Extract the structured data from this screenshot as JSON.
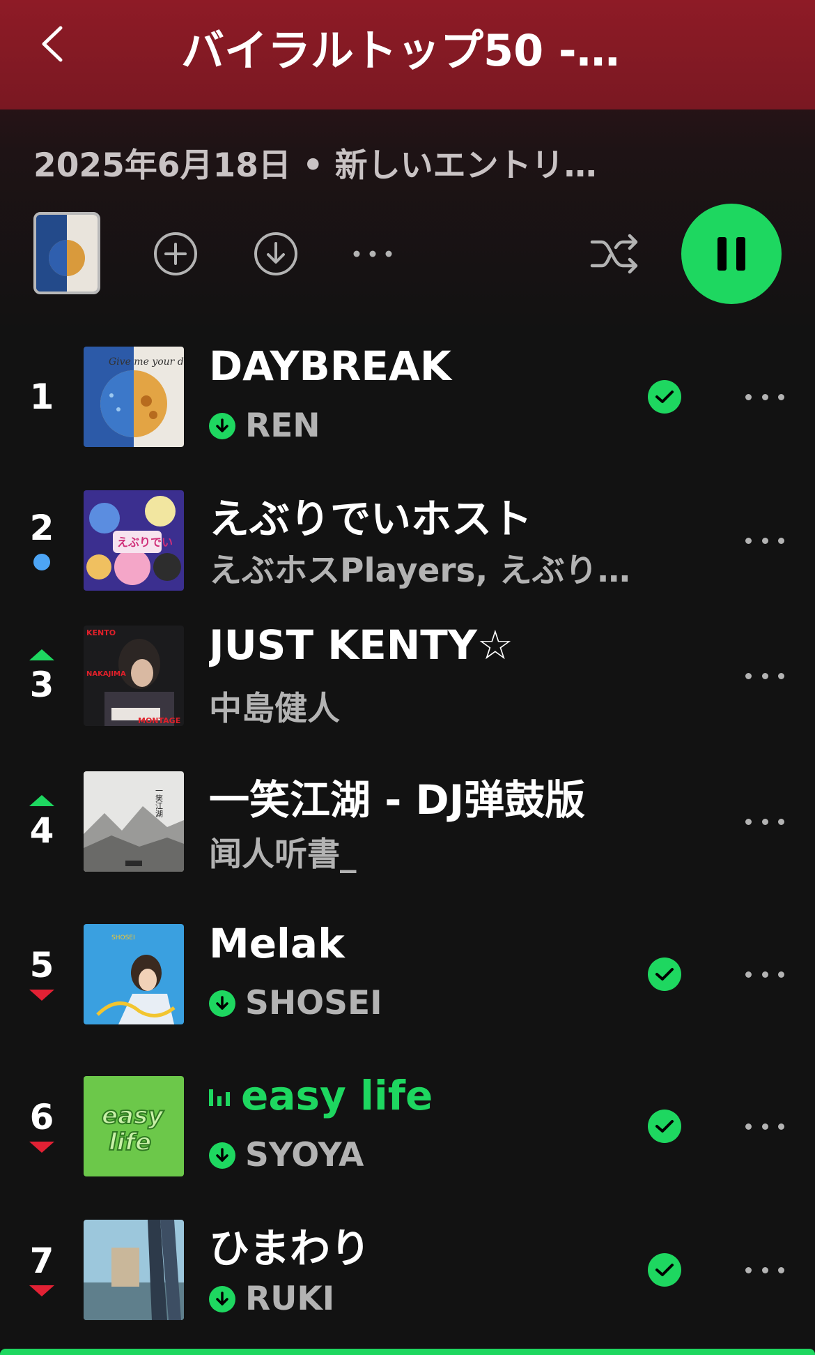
{
  "header": {
    "title": "バイラルトップ50 -…",
    "back_icon": "chevron-left-icon",
    "color": "#8e1b26"
  },
  "subtitle": "2025年6月18日 • 新しいエントリ…",
  "controls": {
    "icons": [
      "add-circle-icon",
      "download-icon",
      "more-icon",
      "shuffle-icon",
      "pause-icon"
    ]
  },
  "colors": {
    "accent": "#1ed760",
    "rank_up": "#1ed760",
    "rank_down": "#e22134",
    "rank_new": "#4da5f5"
  },
  "tracks": [
    {
      "rank": "1",
      "title": "DAYBREAK",
      "artist": "REN",
      "downloaded": true,
      "liked": true,
      "trend": "none"
    },
    {
      "rank": "2",
      "title": "えぶりでいホスト",
      "artist": "えぶホスPlayers, えぶり…",
      "downloaded": false,
      "liked": false,
      "trend": "new"
    },
    {
      "rank": "3",
      "title": "JUST KENTY☆",
      "artist": "中島健人",
      "downloaded": false,
      "liked": false,
      "trend": "up"
    },
    {
      "rank": "4",
      "title": "一笑江湖 - DJ弹鼓版",
      "artist": "闻人听書_",
      "downloaded": false,
      "liked": false,
      "trend": "up"
    },
    {
      "rank": "5",
      "title": "Melak",
      "artist": "SHOSEI",
      "downloaded": true,
      "liked": true,
      "trend": "down"
    },
    {
      "rank": "6",
      "title": "easy life",
      "artist": "SYOYA",
      "downloaded": true,
      "liked": true,
      "trend": "down",
      "playing": true
    },
    {
      "rank": "7",
      "title": "ひまわり",
      "artist": "RUKI",
      "downloaded": true,
      "liked": true,
      "trend": "down"
    }
  ],
  "art_text": {
    "t1": "Give me your day",
    "t3a": "KENTO",
    "t3b": "NAKAJIMA",
    "t3c": "MONTAGE",
    "t4": "一笑江湖",
    "t6": "easy life"
  }
}
